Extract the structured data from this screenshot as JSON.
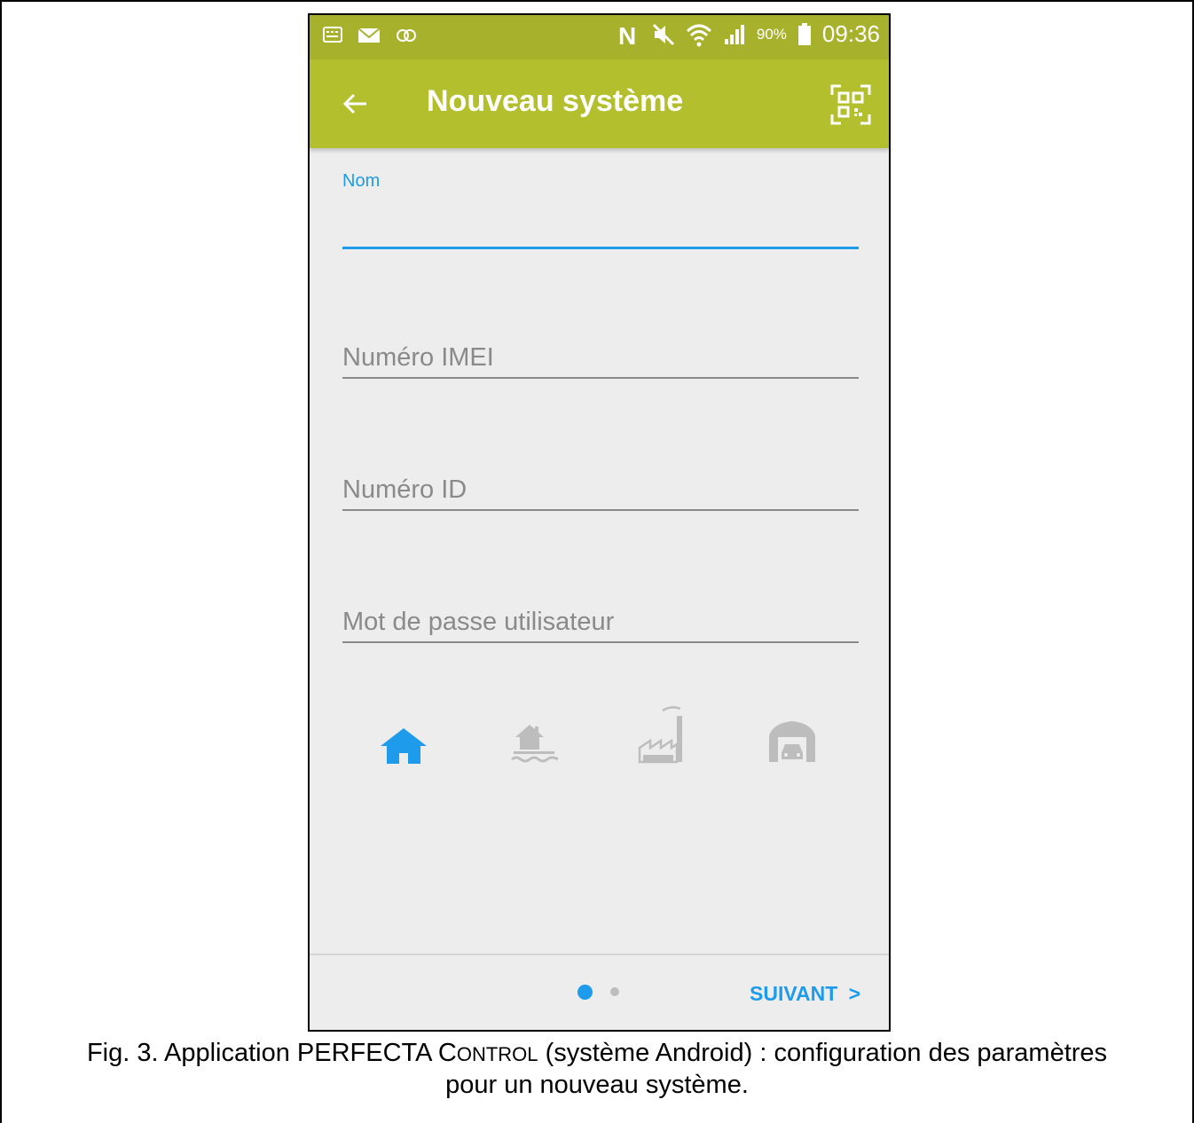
{
  "status_bar": {
    "time": "09:36",
    "battery_percent": "90%",
    "icons": [
      "keyboard-icon",
      "mail-icon",
      "sync-icon",
      "nfc-icon",
      "mute-icon",
      "wifi-icon",
      "signal-icon",
      "battery-icon"
    ]
  },
  "app_bar": {
    "title": "Nouveau système",
    "back_icon": "arrow-left-icon",
    "qr_icon": "qr-code-scan-icon"
  },
  "form": {
    "name": {
      "label": "Nom",
      "value": ""
    },
    "imei": {
      "placeholder": "Numéro IMEI",
      "value": ""
    },
    "id": {
      "placeholder": "Numéro ID",
      "value": ""
    },
    "password": {
      "placeholder": "Mot de passe utilisateur",
      "value": ""
    }
  },
  "system_types": [
    {
      "icon": "house-icon",
      "selected": true
    },
    {
      "icon": "lake-house-icon",
      "selected": false
    },
    {
      "icon": "factory-icon",
      "selected": false
    },
    {
      "icon": "garage-icon",
      "selected": false
    }
  ],
  "pager": {
    "current": 1,
    "total": 2
  },
  "next_button": {
    "label": "SUIVANT",
    "chevron": ">"
  },
  "colors": {
    "accent": "#1e9bea",
    "app_bar": "#b4bf2e",
    "status_bar": "#a8b12c",
    "background": "#ededed",
    "icon_inactive": "#bdbdbd"
  },
  "caption": {
    "prefix": "Fig. 3. Application PERFECTA C",
    "small_caps": "ONTROL",
    "suffix": " (système Android) : configuration des paramètres",
    "line2": "pour un nouveau système."
  }
}
